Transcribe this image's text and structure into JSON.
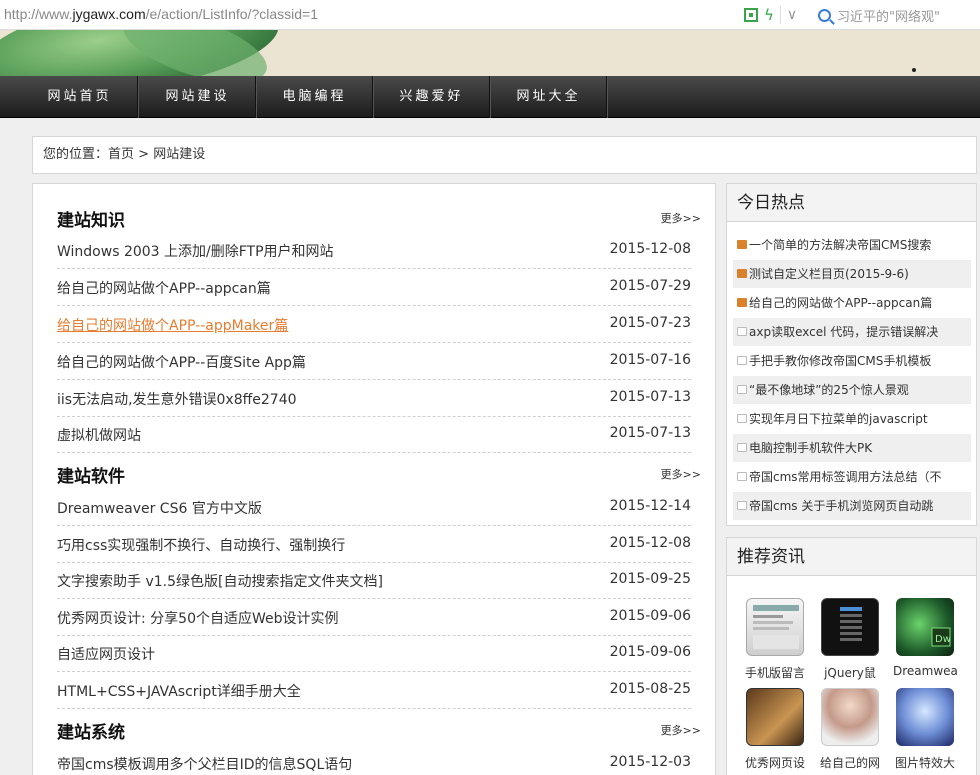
{
  "browser": {
    "url_prefix": "http://www.",
    "url_domain": "jygawx.com",
    "url_path": "/e/action/ListInfo/?classid=1",
    "search_hint": "习近平的\"网络观\""
  },
  "nav": {
    "items": [
      "网站首页",
      "网站建设",
      "电脑编程",
      "兴趣爱好",
      "网址大全"
    ]
  },
  "breadcrumb": {
    "prefix": "您的位置：",
    "home": "首页",
    "separator": ">",
    "current": "网站建设"
  },
  "sections": [
    {
      "title": "建站知识",
      "more": "更多>>",
      "rows": [
        {
          "title": "Windows 2003 上添加/删除FTP用户和网站",
          "date": "2015-12-08"
        },
        {
          "title": "给自己的网站做个APP--appcan篇",
          "date": "2015-07-29"
        },
        {
          "title": "给自己的网站做个APP--appMaker篇",
          "date": "2015-07-23"
        },
        {
          "title": "给自己的网站做个APP--百度Site App篇",
          "date": "2015-07-16"
        },
        {
          "title": "iis无法启动,发生意外错误0x8ffe2740",
          "date": "2015-07-13"
        },
        {
          "title": "虚拟机做网站",
          "date": "2015-07-13"
        }
      ]
    },
    {
      "title": "建站软件",
      "more": "更多>>",
      "rows": [
        {
          "title": "Dreamweaver CS6 官方中文版",
          "date": "2015-12-14"
        },
        {
          "title": "巧用css实现强制不换行、自动换行、强制换行",
          "date": "2015-12-08"
        },
        {
          "title": "文字搜索助手 v1.5绿色版[自动搜索指定文件夹文档]",
          "date": "2015-09-25"
        },
        {
          "title": "优秀网页设计: 分享50个自适应Web设计实例",
          "date": "2015-09-06"
        },
        {
          "title": "自适应网页设计",
          "date": "2015-09-06"
        },
        {
          "title": "HTML+CSS+JAVAscript详细手册大全",
          "date": "2015-08-25"
        }
      ]
    },
    {
      "title": "建站系统",
      "more": "更多>>",
      "rows": [
        {
          "title": "帝国cms模板调用多个父栏目ID的信息SQL语句",
          "date": "2015-12-03"
        }
      ]
    }
  ],
  "hot": {
    "title": "今日热点",
    "items": [
      {
        "text": "一个简单的方法解决帝国CMS搜索",
        "icon": "hot-icon"
      },
      {
        "text": "测试自定义栏目页(2015-9-6)",
        "icon": "hot-icon"
      },
      {
        "text": "给自己的网站做个APP--appcan篇",
        "icon": "hot-icon"
      },
      {
        "text": "axp读取excel 代码，提示错误解决",
        "icon": "list-icon"
      },
      {
        "text": "手把手教你修改帝国CMS手机模板",
        "icon": "list-icon"
      },
      {
        "text": "“最不像地球”的25个惊人景观",
        "icon": "list-icon"
      },
      {
        "text": "实现年月日下拉菜单的javascript",
        "icon": "list-icon"
      },
      {
        "text": "电脑控制手机软件大PK",
        "icon": "list-icon"
      },
      {
        "text": "帝国cms常用标签调用方法总结（不",
        "icon": "list-icon"
      },
      {
        "text": "帝国cms 关于手机浏览网页自动跳",
        "icon": "list-icon"
      }
    ]
  },
  "recommend": {
    "title": "推荐资讯",
    "items": [
      "手机版留言",
      "jQuery鼠",
      "Dreamweaver",
      "优秀网页设",
      "给自己的网",
      "图片特效大"
    ]
  },
  "colors": {
    "link_hover": "#e77c2e",
    "hot_icon": "#d9822b",
    "nav_bg": "#2a2a2a"
  }
}
